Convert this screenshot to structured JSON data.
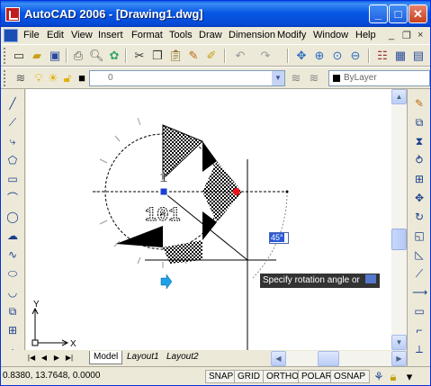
{
  "window": {
    "title": "AutoCAD 2006 - [Drawing1.dwg]",
    "minimize_label": "_",
    "maximize_label": "□",
    "close_label": "✕"
  },
  "menubar": {
    "items": [
      "File",
      "Edit",
      "View",
      "Insert",
      "Format",
      "Tools",
      "Draw",
      "Dimension",
      "Modify",
      "Window",
      "Help"
    ],
    "doc_minimize": "_",
    "doc_restore": "❐",
    "doc_close": "×"
  },
  "layers": {
    "current_layer": "0",
    "color_control": "ByLayer"
  },
  "drawing": {
    "text_main": "101",
    "dynamic_input_value": "45°",
    "ucs_x_label": "X",
    "ucs_y_label": "Y",
    "prompt": "Specify rotation angle or"
  },
  "tabs": {
    "items": [
      "Model",
      "Layout1",
      "Layout2"
    ],
    "active": "Model"
  },
  "status": {
    "coordinates": "0.8380,  13.7648, 0.0000",
    "toggles": [
      "SNAP",
      "GRID",
      "ORTHO",
      "POLAR",
      "OSNAP"
    ]
  },
  "colors": {
    "titlebar": "#0758e5",
    "grip_hot": "#e8141c",
    "grip_cold": "#1d3fd0",
    "cursor_blue": "#1ea0e8"
  }
}
